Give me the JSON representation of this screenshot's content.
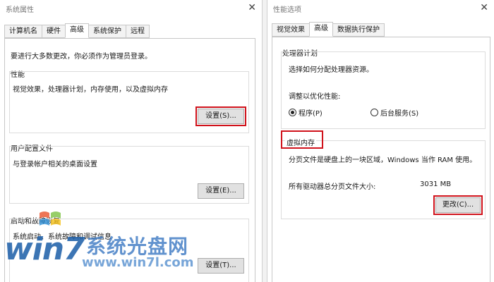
{
  "left_window": {
    "title": "系统属性",
    "tabs": [
      {
        "label": "计算机名",
        "active": false
      },
      {
        "label": "硬件",
        "active": false
      },
      {
        "label": "高级",
        "active": true
      },
      {
        "label": "系统保护",
        "active": false
      },
      {
        "label": "远程",
        "active": false
      }
    ],
    "admin_note": "要进行大多数更改，你必须作为管理员登录。",
    "performance": {
      "label": "性能",
      "description": "视觉效果，处理器计划，内存使用，以及虚拟内存",
      "button": "设置(S)..."
    },
    "user_profiles": {
      "label": "用户配置文件",
      "description": "与登录帐户相关的桌面设置",
      "button": "设置(E)..."
    },
    "startup_recovery": {
      "label": "启动和故障恢复",
      "description": "系统启动、系统故障和调试信息",
      "button": "设置(T)..."
    }
  },
  "right_window": {
    "title": "性能选项",
    "tabs": [
      {
        "label": "视觉效果",
        "active": false
      },
      {
        "label": "高级",
        "active": true
      },
      {
        "label": "数据执行保护",
        "active": false
      }
    ],
    "processor": {
      "label": "处理器计划",
      "description": "选择如何分配处理器资源。",
      "adjust_label": "调整以优化性能:",
      "options": [
        {
          "label": "程序(P)",
          "selected": true
        },
        {
          "label": "后台服务(S)",
          "selected": false
        }
      ]
    },
    "virtual_memory": {
      "label": "虚拟内存",
      "description": "分页文件是硬盘上的一块区域，Windows 当作 RAM 使用。",
      "total_label": "所有驱动器总分页文件大小:",
      "total_value": "3031 MB",
      "button": "更改(C)..."
    }
  },
  "watermark": {
    "logo": "win7",
    "site_name": "系统光盘网",
    "url": "www.win7l.com"
  },
  "colors": {
    "highlight": "#d0121b",
    "watermark_blue": "#1b5da8"
  }
}
